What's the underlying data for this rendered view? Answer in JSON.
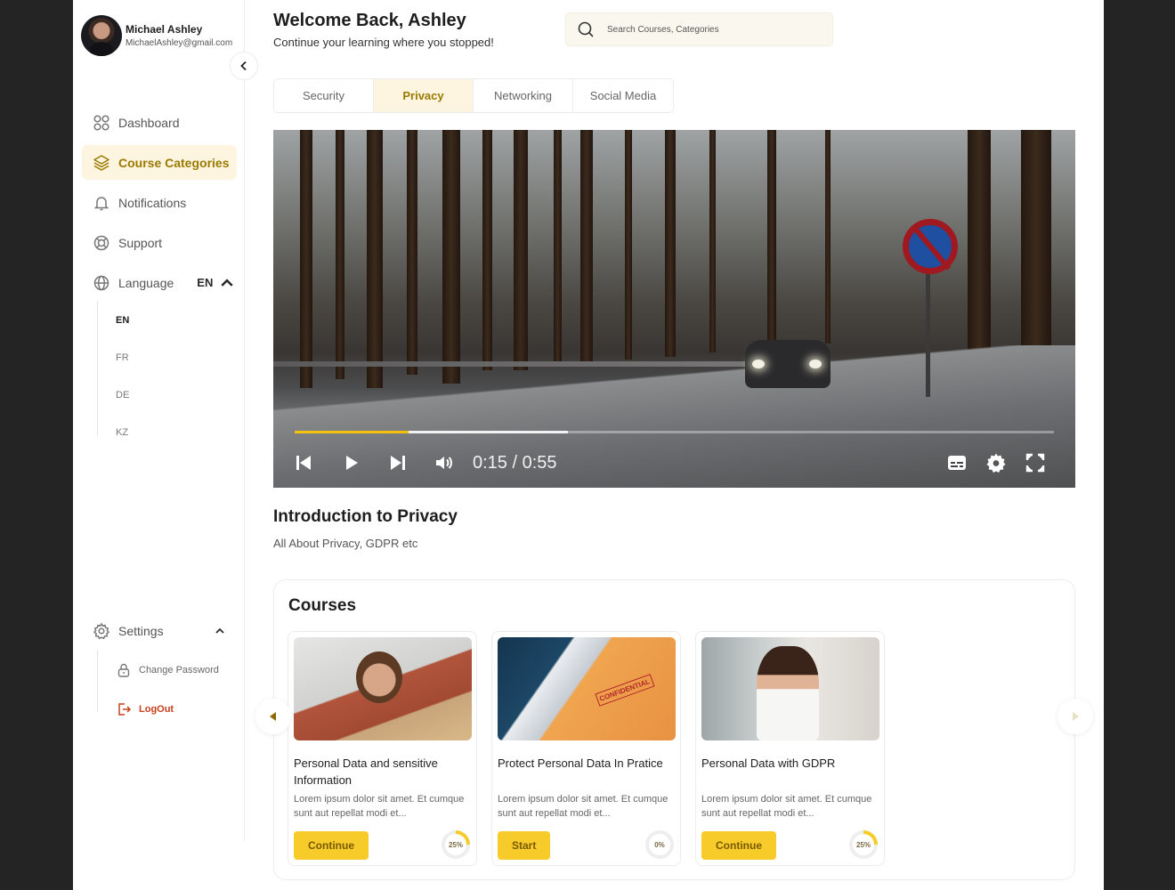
{
  "user": {
    "name": "Michael Ashley",
    "email": "MichaelAshley@gmail.com"
  },
  "sidebar": {
    "items": [
      {
        "label": "Dashboard",
        "icon": "dashboard-grid-icon"
      },
      {
        "label": "Course Categories",
        "icon": "layers-icon",
        "active": true
      },
      {
        "label": "Notifications",
        "icon": "bell-icon"
      },
      {
        "label": "Support",
        "icon": "lifebuoy-icon"
      }
    ],
    "language": {
      "label": "Language",
      "current": "EN",
      "options": [
        "EN",
        "FR",
        "DE",
        "KZ"
      ]
    },
    "settings": {
      "label": "Settings",
      "change_password": "Change Password",
      "logout": "LogOut"
    }
  },
  "header": {
    "title": "Welcome Back, Ashley",
    "subtitle": "Continue your learning where you stopped!",
    "search_placeholder": "Search Courses, Categories"
  },
  "tabs": [
    {
      "label": "Security"
    },
    {
      "label": "Privacy",
      "active": true
    },
    {
      "label": "Networking"
    },
    {
      "label": "Social Media"
    }
  ],
  "player": {
    "time": "0:15 / 0:55",
    "played_fraction": 0.15,
    "buffered_fraction": 0.36
  },
  "lesson": {
    "title": "Introduction to Privacy",
    "subtitle": "All About Privacy, GDPR etc"
  },
  "courses": {
    "title": "Courses",
    "items": [
      {
        "title": "Personal Data and sensitive Information",
        "desc": "Lorem ipsum dolor sit amet. Et cumque sunt aut repellat modi et...",
        "button": "Continue",
        "progress": "25%",
        "progress_value": 25
      },
      {
        "title": "Protect Personal Data In Pratice",
        "desc": "Lorem ipsum dolor sit amet. Et cumque sunt aut repellat modi et...",
        "button": "Start",
        "progress": "0%",
        "progress_value": 0
      },
      {
        "title": "Personal Data with GDPR",
        "desc": "Lorem ipsum dolor sit amet. Et cumque sunt aut repellat modi et...",
        "button": "Continue",
        "progress": "25%",
        "progress_value": 25
      }
    ]
  },
  "colors": {
    "accent": "#f6cb2a",
    "accent_text": "#9a7a00",
    "logout": "#c8401c"
  }
}
